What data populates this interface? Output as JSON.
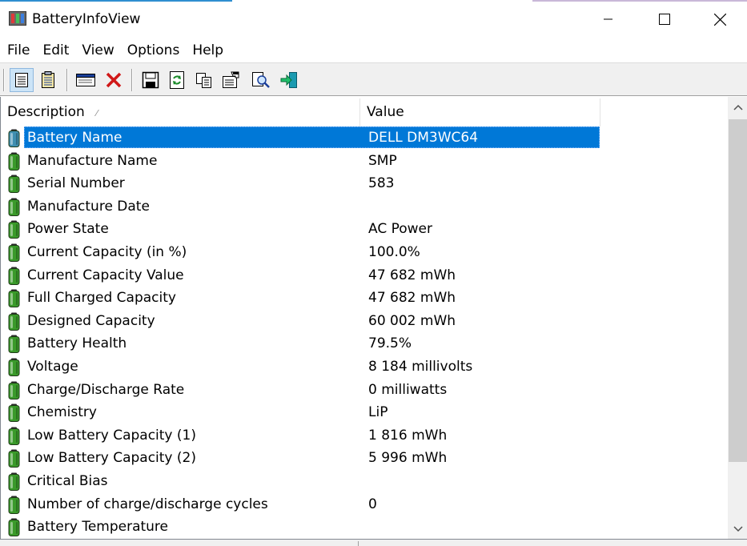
{
  "window": {
    "title": "BatteryInfoView",
    "controls": {
      "minimize": "minimize",
      "maximize": "maximize",
      "close": "close"
    }
  },
  "menu": [
    "File",
    "Edit",
    "View",
    "Options",
    "Help"
  ],
  "toolbar": {
    "buttons": [
      {
        "name": "properties-grid-view-icon",
        "pressed": true
      },
      {
        "name": "log-view-icon",
        "pressed": false
      },
      {
        "name": "display-window-icon",
        "pressed": false
      },
      {
        "name": "delete-icon",
        "pressed": false
      },
      {
        "name": "save-icon",
        "pressed": false
      },
      {
        "name": "refresh-icon",
        "pressed": false
      },
      {
        "name": "copy-icon",
        "pressed": false
      },
      {
        "name": "properties-icon",
        "pressed": false
      },
      {
        "name": "find-icon",
        "pressed": false
      },
      {
        "name": "exit-icon",
        "pressed": false
      }
    ]
  },
  "list": {
    "columns": {
      "description": "Description",
      "value": "Value"
    },
    "selected_index": 0,
    "rows": [
      {
        "description": "Battery Name",
        "value": "DELL DM3WC64"
      },
      {
        "description": "Manufacture Name",
        "value": "SMP"
      },
      {
        "description": "Serial Number",
        "value": "583"
      },
      {
        "description": "Manufacture Date",
        "value": ""
      },
      {
        "description": "Power State",
        "value": "AC Power"
      },
      {
        "description": "Current Capacity (in %)",
        "value": "100.0%"
      },
      {
        "description": "Current Capacity Value",
        "value": "47 682 mWh"
      },
      {
        "description": "Full Charged Capacity",
        "value": "47 682 mWh"
      },
      {
        "description": "Designed Capacity",
        "value": "60 002 mWh"
      },
      {
        "description": "Battery Health",
        "value": "79.5%"
      },
      {
        "description": "Voltage",
        "value": "8 184 millivolts"
      },
      {
        "description": "Charge/Discharge Rate",
        "value": "0 milliwatts"
      },
      {
        "description": "Chemistry",
        "value": "LiP"
      },
      {
        "description": "Low Battery Capacity (1)",
        "value": "1 816 mWh"
      },
      {
        "description": "Low Battery Capacity (2)",
        "value": "5 996 mWh"
      },
      {
        "description": "Critical Bias",
        "value": ""
      },
      {
        "description": "Number of charge/discharge cycles",
        "value": "0"
      },
      {
        "description": "Battery Temperature",
        "value": ""
      }
    ]
  },
  "colors": {
    "selection": "#0078d7",
    "battery_green": "#3a9a2a",
    "battery_selected": "#3f8fb0"
  }
}
